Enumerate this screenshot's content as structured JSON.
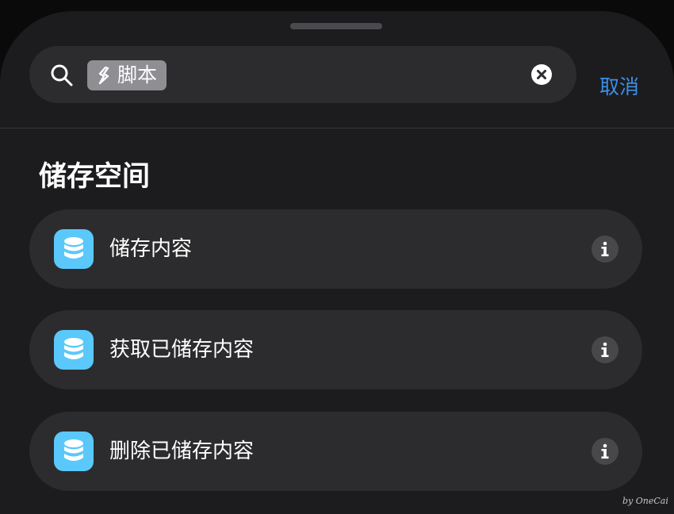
{
  "search": {
    "token_icon": "shortcuts-scripting-icon",
    "token_label": "脚本",
    "cancel_label": "取消"
  },
  "section": {
    "title": "储存空间"
  },
  "actions": [
    {
      "icon": "database-icon",
      "label": "储存内容",
      "info_icon": "info-icon"
    },
    {
      "icon": "database-icon",
      "label": "获取已储存内容",
      "info_icon": "info-icon"
    },
    {
      "icon": "database-icon",
      "label": "删除已储存内容",
      "info_icon": "info-icon"
    }
  ],
  "watermark": "by OneCai",
  "colors": {
    "accent": "#3b8fe8",
    "action_icon_bg": "#5ac8fa",
    "sheet_bg": "#1c1c1e",
    "row_bg": "#2c2c2e"
  }
}
